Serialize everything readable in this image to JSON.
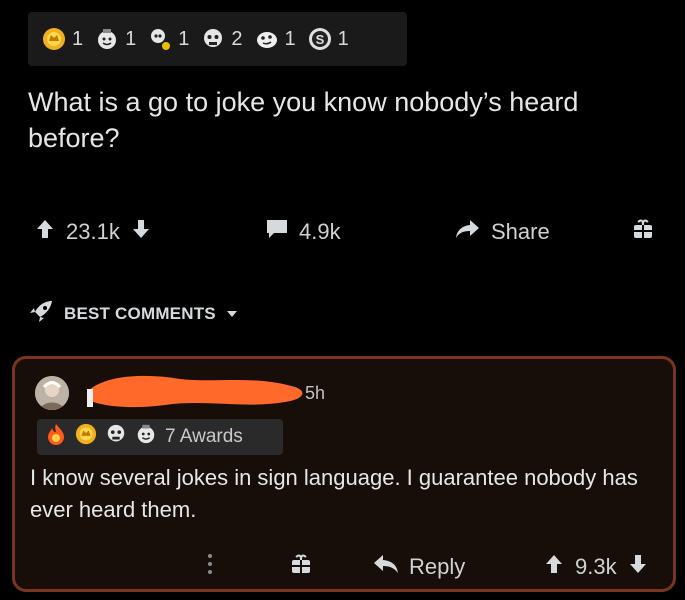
{
  "post": {
    "awards": [
      {
        "icon": "gold-award-icon",
        "count": "1"
      },
      {
        "icon": "wholesome-award-icon",
        "count": "1"
      },
      {
        "icon": "skull-award-icon",
        "count": "1"
      },
      {
        "icon": "laughing-skull-award-icon",
        "count": "2"
      },
      {
        "icon": "silly-face-award-icon",
        "count": "1"
      },
      {
        "icon": "silver-award-icon",
        "count": "1"
      }
    ],
    "title": "What is a go to joke you know nobody’s heard before?",
    "upvotes": "23.1k",
    "comments": "4.9k",
    "share_label": "Share"
  },
  "sort": {
    "label": "BEST COMMENTS"
  },
  "comment": {
    "time": "5h",
    "awards_label": "7 Awards",
    "award_icons": [
      "fire-award-icon",
      "gold-award-icon",
      "laughing-skull-award-icon",
      "wholesome-award-icon"
    ],
    "body": "I know several jokes in sign language. I guarantee nobody has ever heard them.",
    "reply_label": "Reply",
    "votes": "9.3k"
  },
  "colors": {
    "background": "#000000",
    "comment_border": "#7a3520",
    "redaction": "#ff6a2b"
  }
}
